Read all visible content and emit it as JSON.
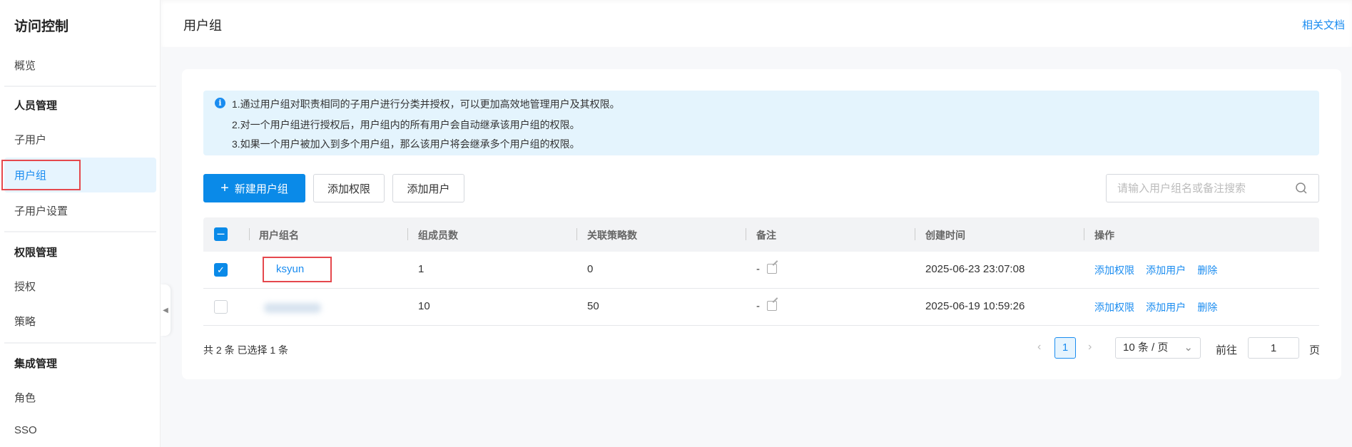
{
  "sidebar": {
    "title": "访问控制",
    "overview": "概览",
    "groups": [
      {
        "title": "人员管理",
        "items": [
          "子用户",
          "用户组",
          "子用户设置"
        ]
      },
      {
        "title": "权限管理",
        "items": [
          "授权",
          "策略"
        ]
      },
      {
        "title": "集成管理",
        "items": [
          "角色",
          "SSO"
        ]
      }
    ],
    "active": "用户组"
  },
  "header": {
    "title": "用户组",
    "doc_link": "相关文档"
  },
  "info": {
    "lines": [
      "1.通过用户组对职责相同的子用户进行分类并授权，可以更加高效地管理用户及其权限。",
      "2.对一个用户组进行授权后，用户组内的所有用户会自动继承该用户组的权限。",
      "3.如果一个用户被加入到多个用户组，那么该用户将会继承多个用户组的权限。"
    ]
  },
  "toolbar": {
    "new_group": "新建用户组",
    "add_permission": "添加权限",
    "add_user": "添加用户",
    "search_placeholder": "请输入用户组名或备注搜索"
  },
  "table": {
    "columns": [
      "用户组名",
      "组成员数",
      "关联策略数",
      "备注",
      "创建时间",
      "操作"
    ],
    "rows": [
      {
        "checked": true,
        "name": "ksyun",
        "members": "1",
        "policies": "0",
        "remark": "-",
        "created": "2025-06-23 23:07:08"
      },
      {
        "checked": false,
        "name": "",
        "members": "10",
        "policies": "50",
        "remark": "-",
        "created": "2025-06-19 10:59:26"
      }
    ],
    "actions": [
      "添加权限",
      "添加用户",
      "删除"
    ]
  },
  "footer": {
    "summary": "共 2 条 已选择 1 条",
    "current_page": "1",
    "page_size": "10 条 / 页",
    "goto_label": "前往",
    "goto_value": "1",
    "page_suffix": "页"
  }
}
